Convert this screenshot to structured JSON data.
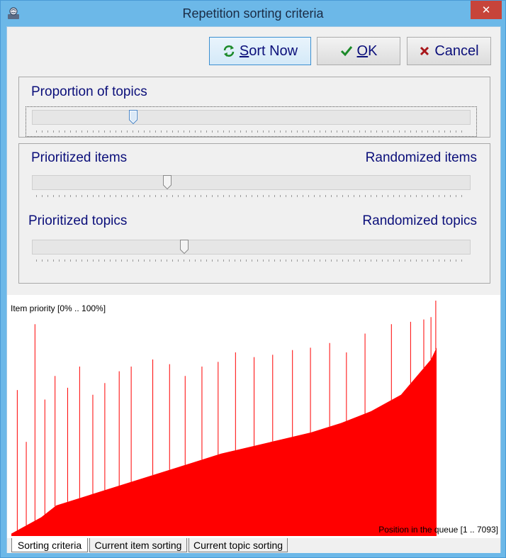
{
  "window": {
    "title": "Repetition sorting criteria",
    "close_label": "✕",
    "accent_color": "#6cb8e8",
    "close_color": "#c7443a"
  },
  "toolbar": {
    "sort_now": {
      "label_prefix": "",
      "label_hot": "S",
      "label_rest": "ort Now",
      "icon": "refresh-icon"
    },
    "ok": {
      "label_hot": "O",
      "label_rest": "K",
      "icon": "checkmark-icon"
    },
    "cancel": {
      "label": "Cancel",
      "icon": "cross-icon"
    }
  },
  "topics_group": {
    "label": "Proportion of topics",
    "slider_value": 0.225
  },
  "balance_group": {
    "items_left": "Prioritized items",
    "items_right": "Randomized items",
    "items_value": 0.305,
    "topics_left": "Prioritized topics",
    "topics_right": "Randomized topics",
    "topics_value": 0.345
  },
  "chart_data": {
    "type": "bar",
    "ylabel": "Item priority [0% .. 100%]",
    "xlabel": "Position in the queue [1 .. 7093]",
    "ylim": [
      0,
      100
    ],
    "x_range": [
      1,
      7093
    ],
    "color": "#ff0000",
    "base_curve": [
      {
        "position": 1,
        "priority": 1
      },
      {
        "position": 500,
        "priority": 8
      },
      {
        "position": 750,
        "priority": 13
      },
      {
        "position": 1000,
        "priority": 15
      },
      {
        "position": 1500,
        "priority": 19
      },
      {
        "position": 2000,
        "priority": 23
      },
      {
        "position": 2500,
        "priority": 27
      },
      {
        "position": 3000,
        "priority": 31
      },
      {
        "position": 3500,
        "priority": 35
      },
      {
        "position": 4000,
        "priority": 38
      },
      {
        "position": 4500,
        "priority": 41
      },
      {
        "position": 5000,
        "priority": 44
      },
      {
        "position": 5500,
        "priority": 48
      },
      {
        "position": 6000,
        "priority": 53
      },
      {
        "position": 6500,
        "priority": 60
      },
      {
        "position": 7000,
        "priority": 75
      },
      {
        "position": 7093,
        "priority": 80
      }
    ],
    "peaks": [
      {
        "position": 100,
        "priority": 62
      },
      {
        "position": 250,
        "priority": 40
      },
      {
        "position": 395,
        "priority": 90
      },
      {
        "position": 560,
        "priority": 58
      },
      {
        "position": 730,
        "priority": 68
      },
      {
        "position": 940,
        "priority": 63
      },
      {
        "position": 1140,
        "priority": 72
      },
      {
        "position": 1360,
        "priority": 60
      },
      {
        "position": 1560,
        "priority": 65
      },
      {
        "position": 1800,
        "priority": 70
      },
      {
        "position": 2000,
        "priority": 72
      },
      {
        "position": 2360,
        "priority": 75
      },
      {
        "position": 2640,
        "priority": 73
      },
      {
        "position": 2900,
        "priority": 68
      },
      {
        "position": 3180,
        "priority": 72
      },
      {
        "position": 3450,
        "priority": 74
      },
      {
        "position": 3740,
        "priority": 78
      },
      {
        "position": 4050,
        "priority": 76
      },
      {
        "position": 4360,
        "priority": 77
      },
      {
        "position": 4690,
        "priority": 79
      },
      {
        "position": 4990,
        "priority": 80
      },
      {
        "position": 5310,
        "priority": 82
      },
      {
        "position": 5590,
        "priority": 78
      },
      {
        "position": 5900,
        "priority": 86
      },
      {
        "position": 6340,
        "priority": 90
      },
      {
        "position": 6660,
        "priority": 91
      },
      {
        "position": 6880,
        "priority": 92
      },
      {
        "position": 7000,
        "priority": 93
      },
      {
        "position": 7080,
        "priority": 100
      }
    ]
  },
  "tabs": [
    {
      "label": "Sorting criteria",
      "active": true
    },
    {
      "label": "Current item sorting",
      "active": false
    },
    {
      "label": "Current topic sorting",
      "active": false
    }
  ]
}
